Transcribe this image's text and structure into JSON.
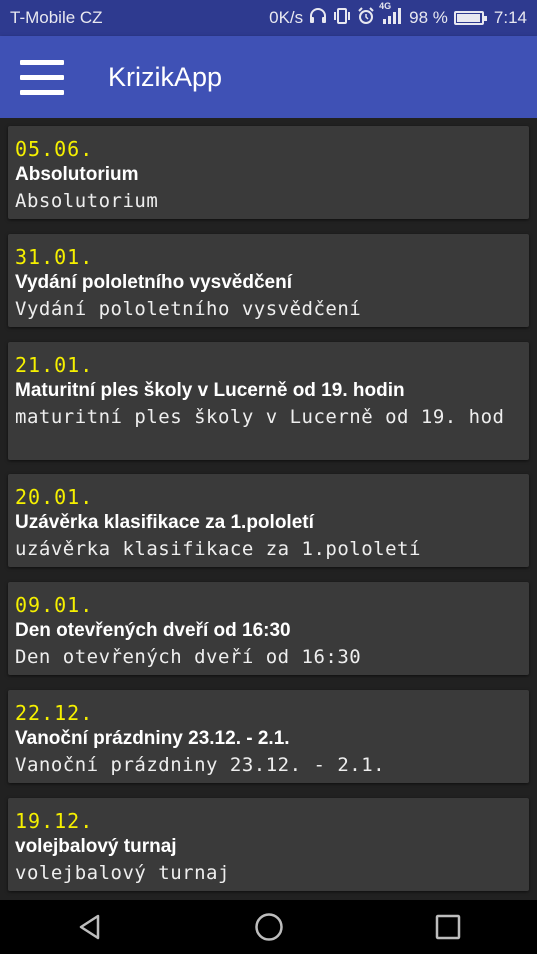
{
  "status_bar": {
    "carrier": "T-Mobile CZ",
    "speed": "0K/s",
    "network": "4G",
    "battery_percent": "98 %",
    "battery_level": 0.98,
    "time": "7:14"
  },
  "app_bar": {
    "title": "KrizikApp",
    "menu_icon": "hamburger-menu-icon"
  },
  "events": [
    {
      "date": "05.06.",
      "title": "Absolutorium",
      "description": "Absolutorium"
    },
    {
      "date": "31.01.",
      "title": "Vydání pololetního vysvědčení",
      "description": "Vydání pololetního vysvědčení"
    },
    {
      "date": "21.01.",
      "title": "Maturitní ples školy v Lucerně od 19. hodin",
      "description": "maturitní ples školy v Lucerně od 19. hod"
    },
    {
      "date": "20.01.",
      "title": "Uzávěrka klasifikace za 1.pololetí",
      "description": "uzávěrka klasifikace za 1.pololetí"
    },
    {
      "date": "09.01.",
      "title": "Den otevřených dveří od 16:30",
      "description": "Den otevřených dveří od 16:30"
    },
    {
      "date": "22.12.",
      "title": "Vanoční prázdniny 23.12. - 2.1.",
      "description": "Vanoční prázdniny 23.12. - 2.1."
    },
    {
      "date": "19.12.",
      "title": "volejbalový turnaj",
      "description": "volejbalový turnaj"
    }
  ],
  "nav_bar": {
    "back_icon": "back-triangle-icon",
    "home_icon": "home-circle-icon",
    "recents_icon": "recents-square-icon"
  },
  "colors": {
    "status_bar": "#2e3a8f",
    "app_bar": "#3f51b5",
    "background": "#212121",
    "card": "#3a3a3a",
    "date_text": "#f5f000"
  }
}
